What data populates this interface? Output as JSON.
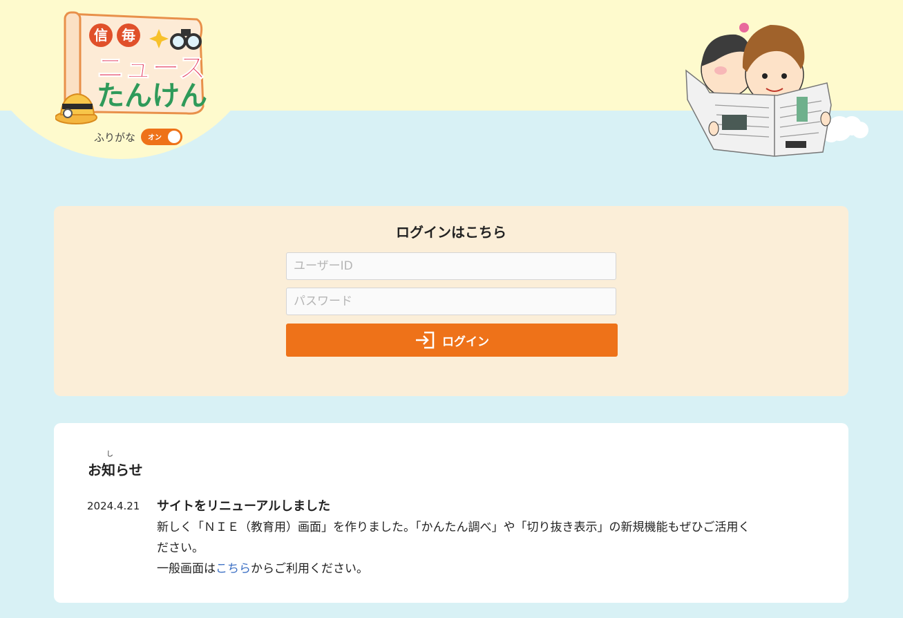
{
  "header": {
    "logo": {
      "lines": [
        "信毎",
        "ニュース",
        "たんけん"
      ],
      "tag1": "信",
      "tag2": "毎",
      "line2": "ニュース",
      "line3": "たんけん"
    },
    "furigana": {
      "label": "ふりがな",
      "toggle_text": "オン",
      "state": "on"
    },
    "mascot_icon": "kids-reading-newspaper"
  },
  "login": {
    "title": "ログインはこちら",
    "user_placeholder": "ユーザーID",
    "user_value": "",
    "password_placeholder": "パスワード",
    "password_value": "",
    "button_label": "ログイン",
    "button_icon": "login-icon"
  },
  "notice": {
    "title": "お知らせ",
    "title_ruby": "し",
    "items": [
      {
        "date": "2024.4.21",
        "headline": "サイトをリニューアルしました",
        "body_line1": "新しく「ＮＩＥ（教育用）画面」を作りました。「かんたん調べ」や「切り抜き表示」の新規機能もぜひご活用く",
        "body_line2": "ださい。",
        "body_line3_prefix": "一般画面は",
        "body_line3_link": "こちら",
        "body_line3_suffix": "からご利用ください。"
      }
    ]
  },
  "colors": {
    "background": "#d8f1f5",
    "header_band": "#fefacd",
    "login_panel": "#fbeed8",
    "accent": "#ee7219",
    "link": "#3b6fc4"
  }
}
